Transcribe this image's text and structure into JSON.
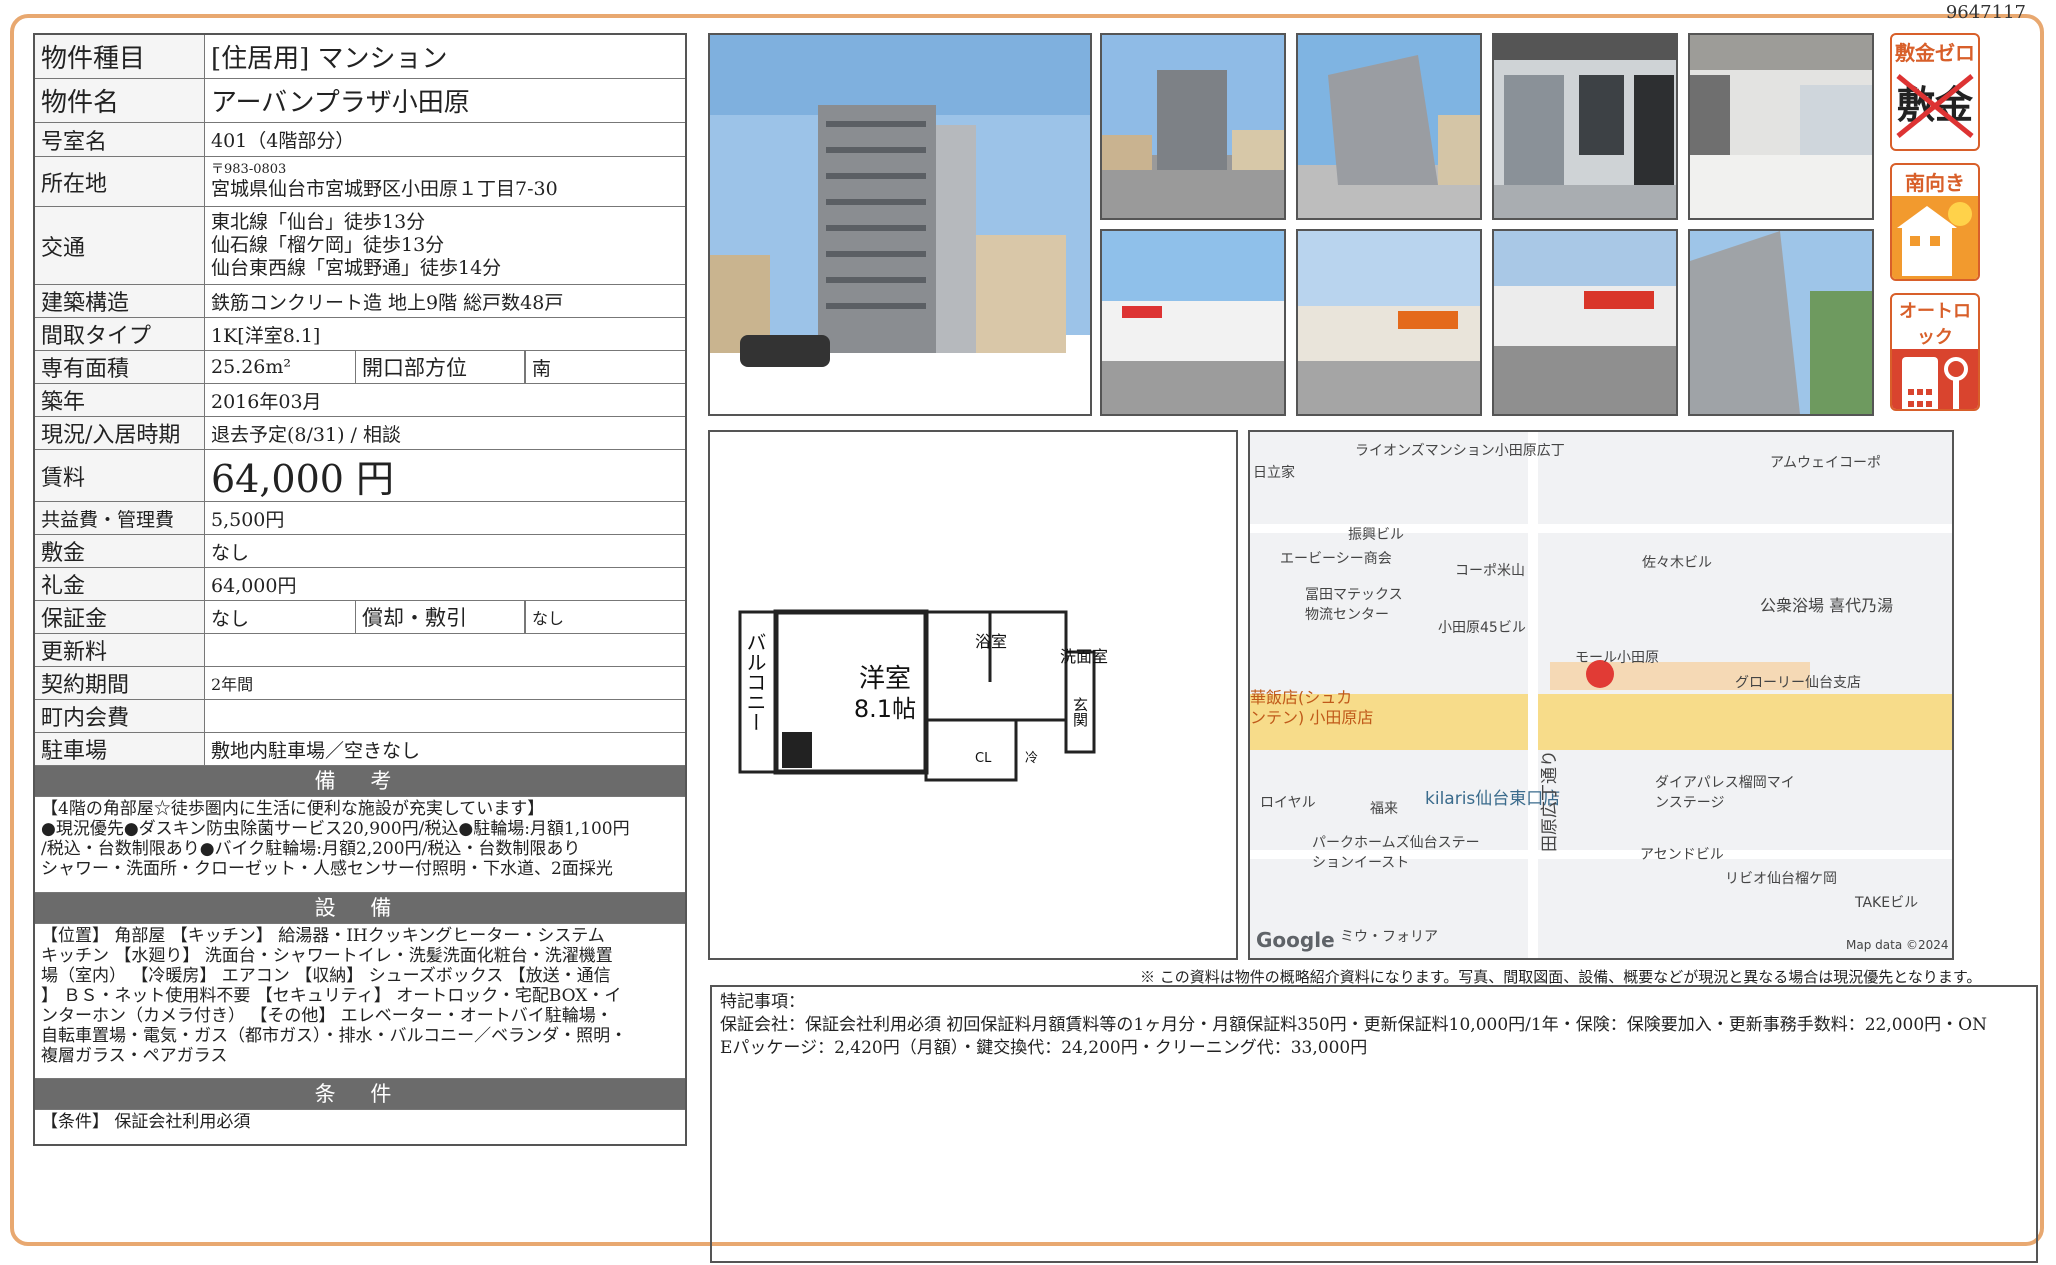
{
  "doc_id": "9647117",
  "property": {
    "type_label": "物件種目",
    "type_value": "[住居用] マンション",
    "name_label": "物件名",
    "name_value": "アーバンプラザ小田原",
    "room_label": "号室名",
    "room_value": "401（4階部分）",
    "address_label": "所在地",
    "postal": "〒983-0803",
    "address": "宮城県仙台市宮城野区小田原１丁目7-30",
    "transport_label": "交通",
    "transport": [
      "東北線「仙台」徒歩13分",
      "仙石線「榴ケ岡」徒歩13分",
      "仙台東西線「宮城野通」徒歩14分"
    ],
    "structure_label": "建築構造",
    "structure_value": "鉄筋コンクリート造 地上9階 総戸数48戸",
    "layout_label": "間取タイプ",
    "layout_value": "1K[洋室8.1]",
    "area_label": "専有面積",
    "area_value": "25.26m²",
    "facing_label": "開口部方位",
    "facing_value": "南",
    "built_label": "築年",
    "built_value": "2016年03月",
    "status_label": "現況/入居時期",
    "status_value": "退去予定(8/31) / 相談",
    "rent_label": "賃料",
    "rent_value": "64,000 円",
    "fee_label": "共益費・管理費",
    "fee_value": "5,500円",
    "deposit_label": "敷金",
    "deposit_value": "なし",
    "keymoney_label": "礼金",
    "keymoney_value": "64,000円",
    "guarantee_label": "保証金",
    "guarantee_value": "なし",
    "amort_label": "償却・敷引",
    "amort_value": "なし",
    "renewal_label": "更新料",
    "renewal_value": "",
    "contract_label": "契約期間",
    "contract_value": "2年間",
    "community_label": "町内会費",
    "community_value": "",
    "parking_label": "駐車場",
    "parking_value": "敷地内駐車場／空きなし"
  },
  "remarks": {
    "title": "備 考",
    "lines": [
      "【4階の角部屋☆徒歩圏内に生活に便利な施設が充実しています】",
      "●現況優先●ダスキン防虫除菌サービス20,900円/税込●駐輪場:月額1,100円",
      "/税込・台数制限あり●バイク駐輪場:月額2,200円/税込・台数制限あり",
      "シャワー・洗面所・クローゼット・人感センサー付照明・下水道、2面採光"
    ]
  },
  "facilities": {
    "title": "設 備",
    "lines": [
      "【位置】 角部屋 【キッチン】 給湯器・IHクッキングヒーター・システム",
      "キッチン 【水廻り】 洗面台・シャワートイレ・洗髪洗面化粧台・洗濯機置",
      "場（室内） 【冷暖房】 エアコン 【収納】 シューズボックス 【放送・通信",
      "】 ＢＳ・ネット使用料不要 【セキュリティ】 オートロック・宅配BOX・イ",
      "ンターホン（カメラ付き） 【その他】 エレベーター・オートバイ駐輪場・",
      "自転車置場・電気・ガス（都市ガス）・排水・バルコニー／ベランダ・照明・",
      "複層ガラス・ペアガラス"
    ]
  },
  "conditions": {
    "title": "条 件",
    "text": "【条件】 保証会社利用必須"
  },
  "badges": [
    {
      "title": "敷金ゼロ",
      "sub": "敷金",
      "icon": "no-deposit-icon"
    },
    {
      "title": "南向き",
      "icon": "sun-house-icon"
    },
    {
      "title": "オートロック",
      "icon": "autolock-icon"
    }
  ],
  "floorplan": {
    "room_name": "洋室",
    "room_size": "8.1帖",
    "balcony": "バルコニー",
    "bath": "浴室",
    "washroom": "洗面室",
    "entrance": "玄関",
    "closet": "CL",
    "fridge": "冷"
  },
  "map": {
    "labels": [
      "ライオンズマンション小田原広丁",
      "アムウェイコーポ",
      "日立家",
      "振興ビル",
      "エービーシー商会",
      "コーポ米山",
      "佐々木ビル",
      "冨田マテックス物流センター",
      "公衆浴場 喜代乃湯",
      "小田原45ビル",
      "モール小田原",
      "グローリー仙台支店",
      "華飯店(シュカ",
      "ンテン) 小田原店",
      "ロイヤル",
      "福来",
      "kilaris仙台東口店",
      "ダイアパレス榴岡マインステージ",
      "パークホームズ仙台ステーションイースト",
      "アセンドビル",
      "リビオ仙台榴ケ岡",
      "TAKEビル",
      "田原広丁通り",
      "ミウ・フォリア"
    ],
    "google": "Google",
    "attribution": "Map data ©2024"
  },
  "disclaimer": "※ この資料は物件の概略紹介資料になります。写真、間取図面、設備、概要などが現況と異なる場合は現況優先となります。",
  "special": {
    "title": "特記事項：",
    "line1": "保証会社：保証会社利用必須 初回保証料月額賃料等の1ヶ月分・月額保証料350円・更新保証料10,000円/1年・保険：保険要加入・更新事務手数料：22,000円・ON",
    "line2": "Eパッケージ：2,420円（月額）・鍵交換代：24,200円・クリーニング代：33,000円"
  }
}
